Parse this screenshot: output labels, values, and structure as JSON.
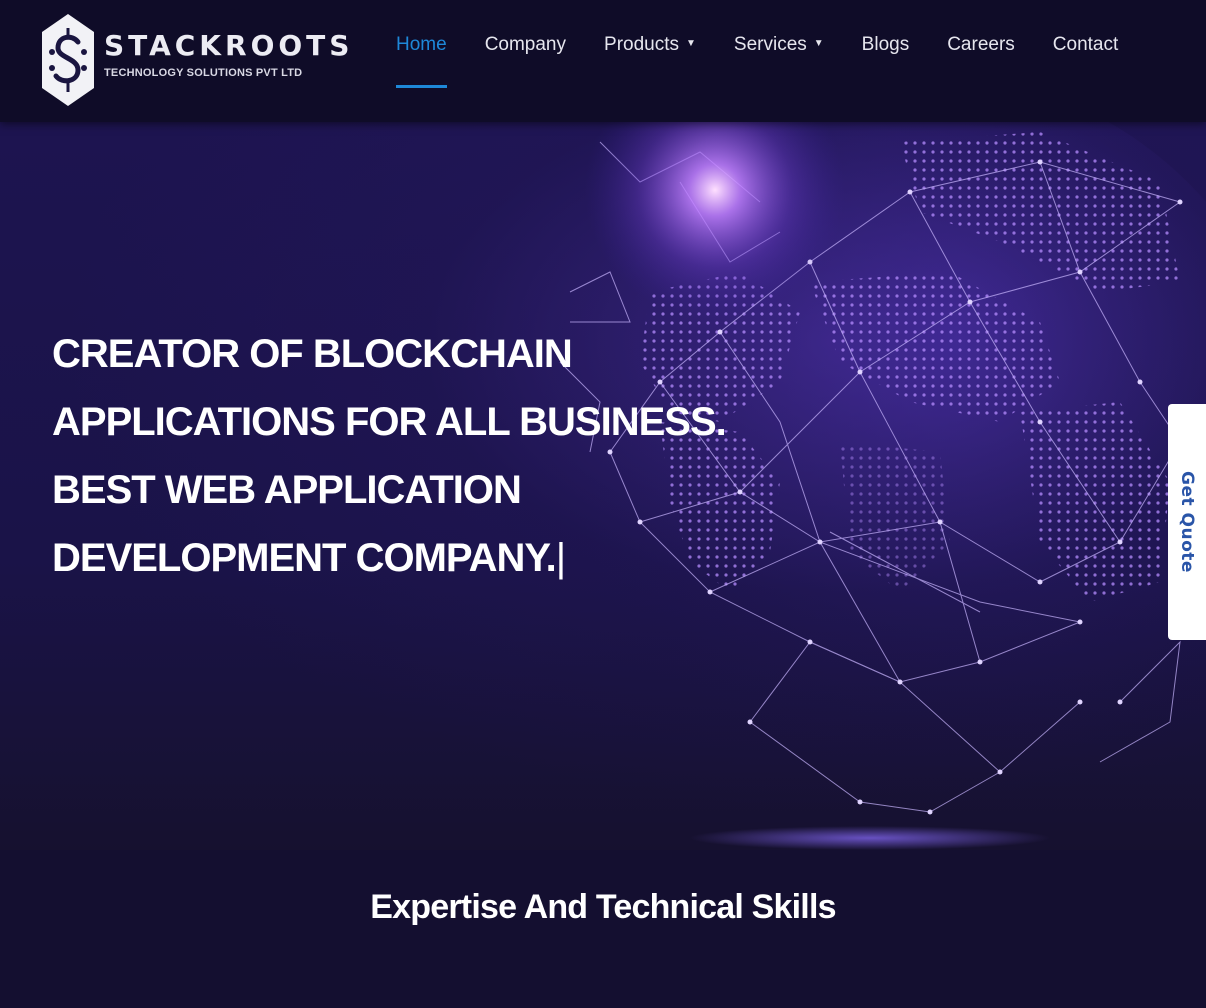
{
  "brand": {
    "name": "STACKROOTS",
    "tagline": "TECHNOLOGY SOLUTIONS PVT LTD",
    "logo_icon": "hexagon-s-logo-icon"
  },
  "nav": {
    "items": [
      {
        "label": "Home",
        "active": true,
        "dropdown": false
      },
      {
        "label": "Company",
        "active": false,
        "dropdown": false
      },
      {
        "label": "Products",
        "active": false,
        "dropdown": true
      },
      {
        "label": "Services",
        "active": false,
        "dropdown": true
      },
      {
        "label": "Blogs",
        "active": false,
        "dropdown": false
      },
      {
        "label": "Careers",
        "active": false,
        "dropdown": false
      },
      {
        "label": "Contact",
        "active": false,
        "dropdown": false
      }
    ],
    "dropdown_icon": "caret-down-icon"
  },
  "hero": {
    "lines": [
      "CREATOR OF BLOCKCHAIN",
      "APPLICATIONS FOR ALL BUSINESS.",
      "BEST WEB APPLICATION",
      "DEVELOPMENT COMPANY."
    ],
    "cursor": "|",
    "background_graphic": "network-globe-illustration"
  },
  "side_tab": {
    "label": "Get Quote"
  },
  "section": {
    "title": "Expertise And Technical Skills"
  },
  "colors": {
    "header_bg": "#0f0c28",
    "page_bg": "#14102e",
    "accent": "#1e88d8",
    "globe_glow": "#b070ff",
    "quote_text": "#2a55a8"
  }
}
